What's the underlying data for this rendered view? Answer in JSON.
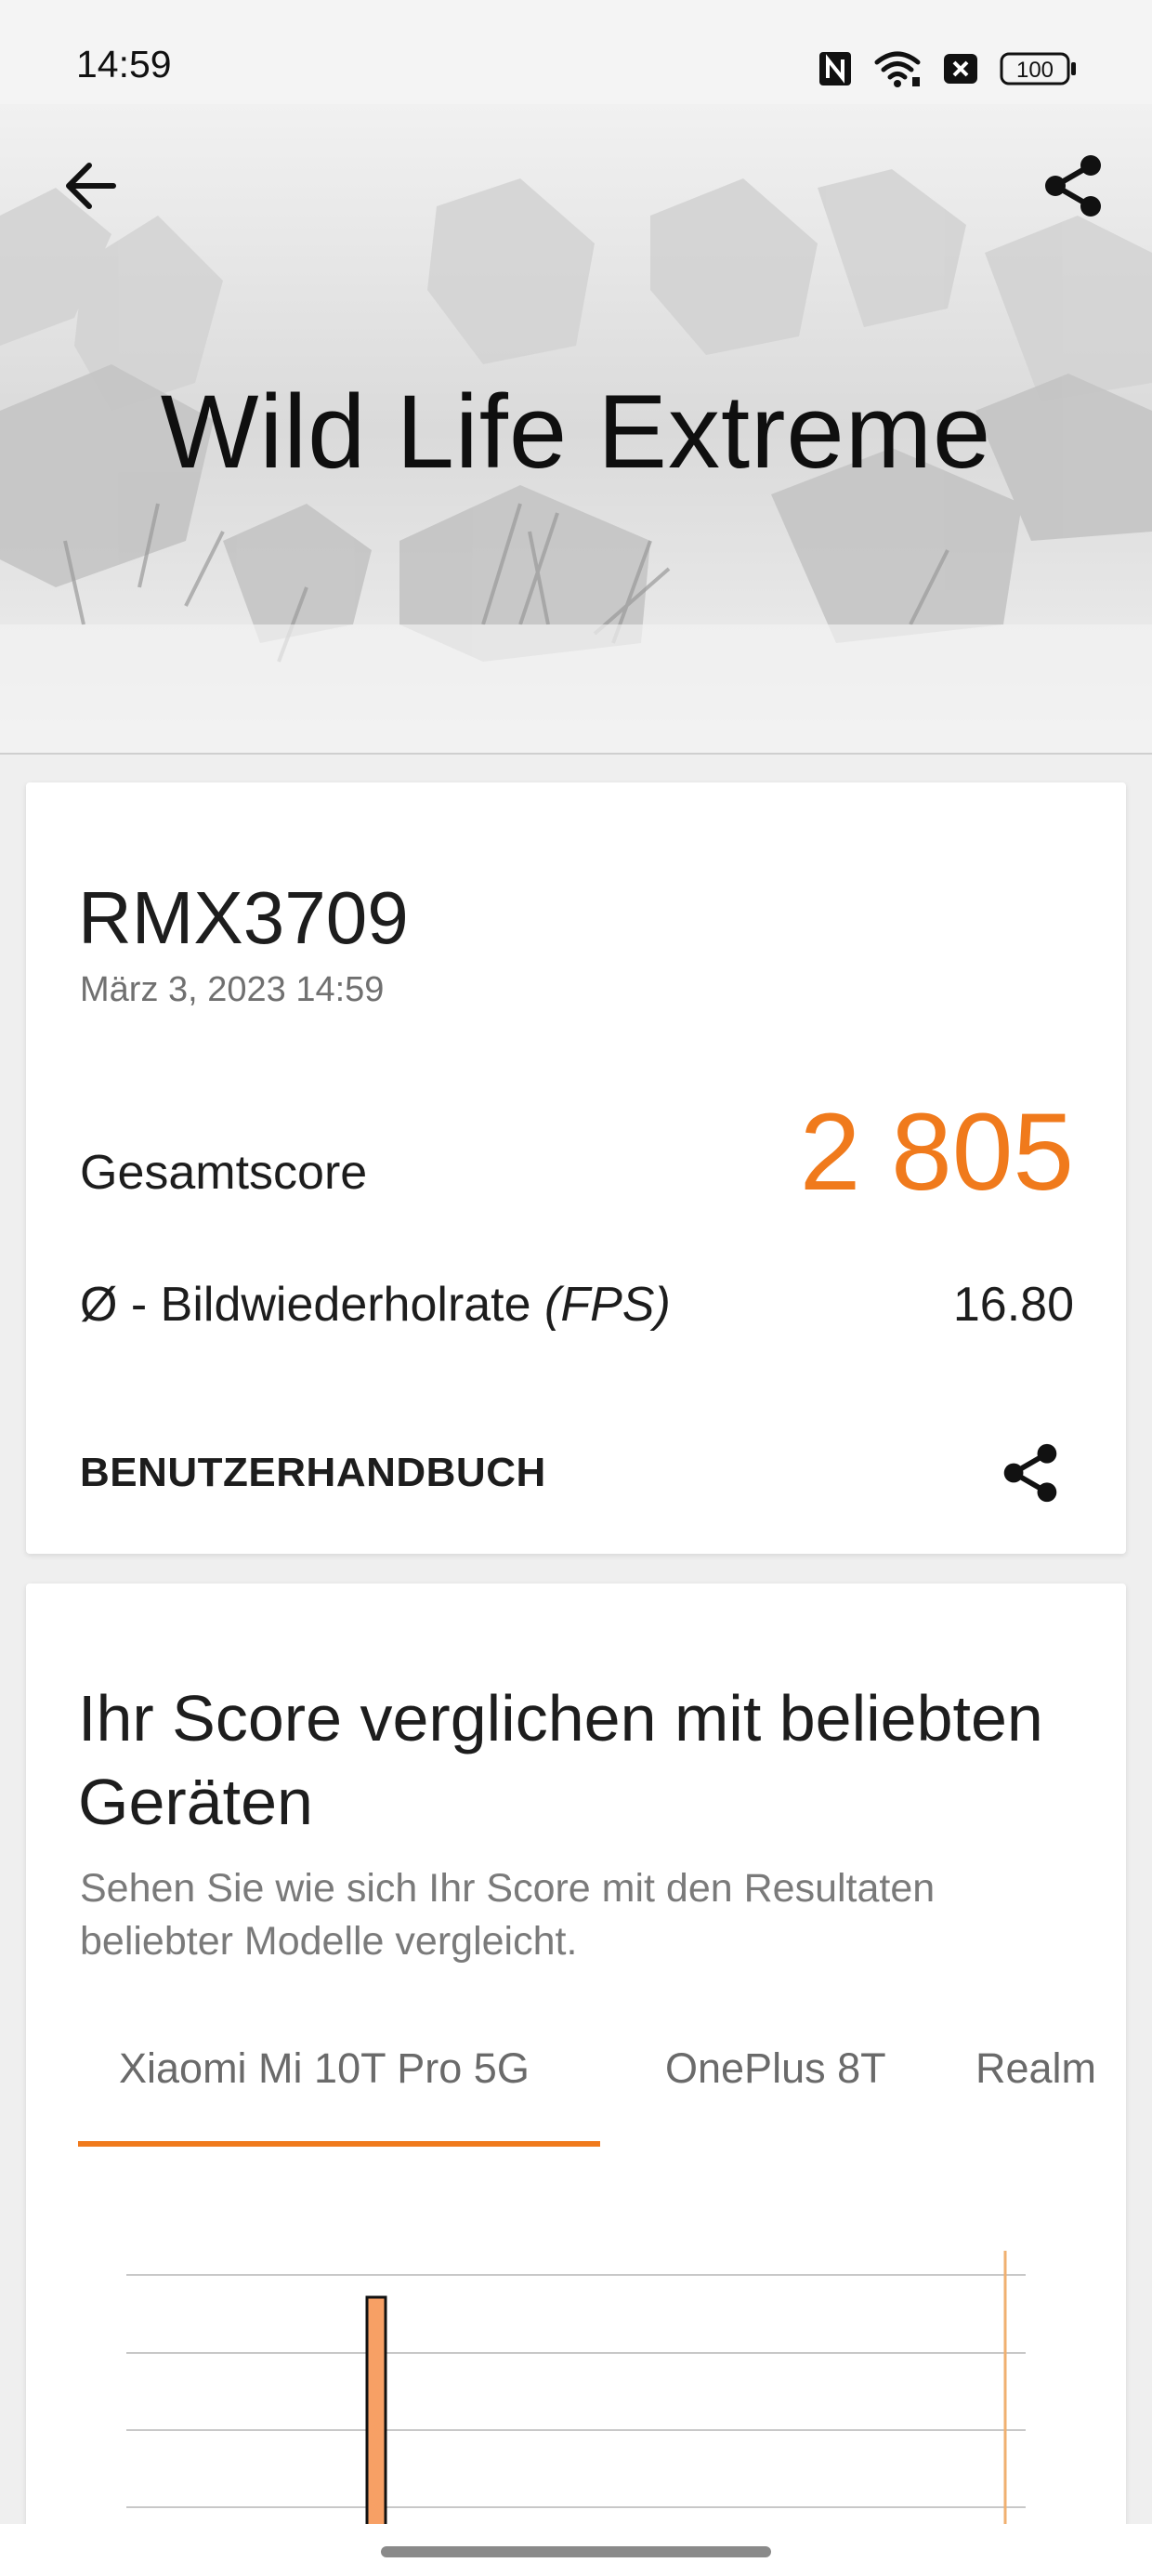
{
  "status_bar": {
    "time": "14:59",
    "battery": "100",
    "icons": [
      "nfc-icon",
      "wifi-icon",
      "sim-off-icon",
      "battery-icon"
    ]
  },
  "header": {
    "title": "Wild Life Extreme",
    "back_icon": "arrow-left-icon",
    "share_icon": "share-icon"
  },
  "result": {
    "device": "RMX3709",
    "date": "März 3, 2023 14:59",
    "overall_label": "Gesamtscore",
    "overall_value": "2 805",
    "fps_label_prefix": "Ø - Bildwiederholrate ",
    "fps_label_unit": "(FPS)",
    "fps_value": "16.80",
    "manual_label": "BENUTZERHANDBUCH",
    "accent_color": "#f07a1c"
  },
  "comparison": {
    "title": "Ihr Score verglichen mit beliebten Geräten",
    "subtitle": "Sehen Sie wie sich Ihr Score mit den Resultaten beliebter Modelle vergleicht.",
    "tabs": [
      {
        "label": "Xiaomi Mi 10T Pro 5G",
        "selected": true
      },
      {
        "label": "OnePlus 8T",
        "selected": false
      },
      {
        "label": "Realm",
        "selected": false
      }
    ]
  }
}
